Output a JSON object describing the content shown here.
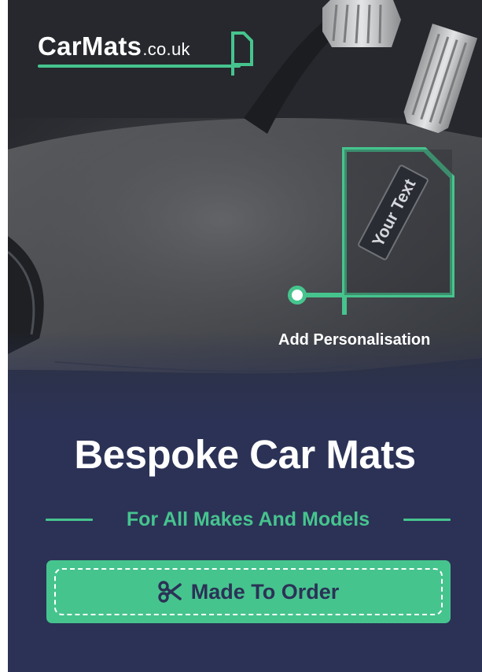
{
  "brand": {
    "logo_main": "CarMats",
    "logo_tld": ".co.uk",
    "accent_color": "#46c48e",
    "navy_color": "#2b3256"
  },
  "photo": {
    "embroidery_text": "Your Text",
    "callout_label": "Add Personalisation"
  },
  "headline": "Bespoke Car Mats",
  "subheadline": "For All Makes And Models",
  "cta": {
    "label": "Made To Order",
    "icon": "scissors-icon"
  }
}
